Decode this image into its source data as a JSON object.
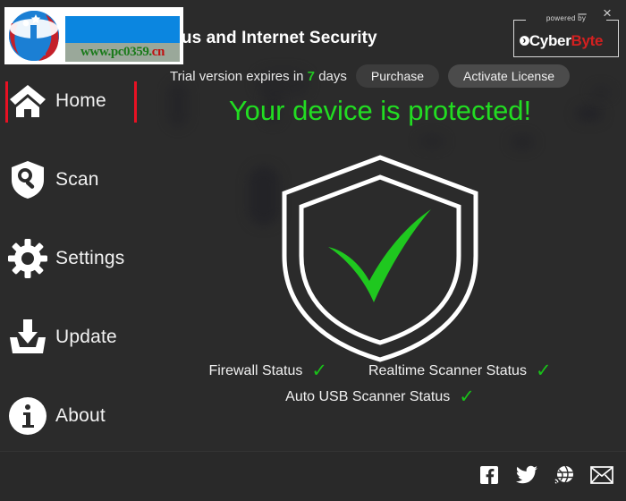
{
  "window": {
    "minimize_label": "–",
    "close_label": "×"
  },
  "header": {
    "app_title": "irus and Internet Security",
    "trial_prefix": "Trial version expires in",
    "trial_days": "7",
    "trial_suffix": "days",
    "purchase_label": "Purchase",
    "activate_label": "Activate License"
  },
  "powered_by": {
    "prefix": "powered by",
    "brand_part1": "Cyber",
    "brand_part2": "Byte"
  },
  "sidebar": {
    "items": [
      {
        "label": "Home",
        "icon": "home-icon",
        "active": true
      },
      {
        "label": "Scan",
        "icon": "scan-shield-icon",
        "active": false
      },
      {
        "label": "Settings",
        "icon": "gear-icon",
        "active": false
      },
      {
        "label": "Update",
        "icon": "download-icon",
        "active": false
      },
      {
        "label": "About",
        "icon": "info-icon",
        "active": false
      }
    ]
  },
  "main": {
    "status_headline": "Your device is protected!",
    "shield_icon": "shield-check-icon",
    "status_rows": [
      [
        {
          "label": "Firewall Status",
          "check": "✓"
        },
        {
          "label": "Realtime Scanner Status",
          "check": "✓"
        }
      ],
      [
        {
          "label": "Auto USB Scanner Status",
          "check": "✓"
        }
      ]
    ]
  },
  "footer": {
    "social": [
      {
        "name": "facebook-icon"
      },
      {
        "name": "twitter-icon"
      },
      {
        "name": "globe-icon"
      },
      {
        "name": "email-icon"
      }
    ]
  },
  "watermark": {
    "url_text": "www.pc0359.",
    "url_suffix": "cn"
  },
  "colors": {
    "accent_red": "#e81123",
    "status_green": "#22dd22",
    "check_green": "#19c119",
    "brand_red": "#d32020",
    "background": "#2b2b2b"
  }
}
